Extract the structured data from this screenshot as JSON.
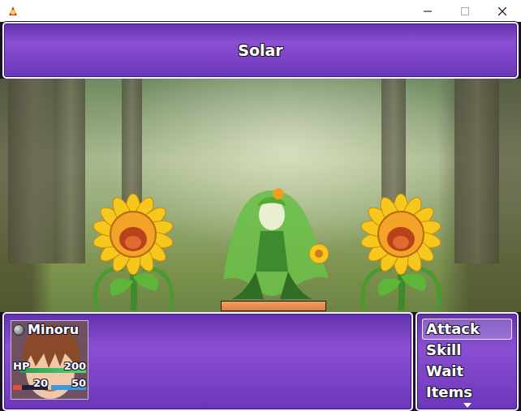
{
  "help_window": {
    "text": "Solar"
  },
  "enemies": [
    {
      "kind": "sunflower",
      "selected": false
    },
    {
      "kind": "dryad",
      "selected": true,
      "level": 1.0
    },
    {
      "kind": "sunflower",
      "selected": false
    }
  ],
  "actor": {
    "name": "Minoru",
    "hp_label": "HP",
    "hp": "200",
    "hp_level": 1.0,
    "gauges": [
      {
        "value": "20",
        "level": 0.25,
        "color": "#e0503a"
      },
      {
        "value": "50",
        "level": 1.0,
        "color": "#3a9ae0"
      }
    ]
  },
  "commands": [
    {
      "label": "Attack",
      "selected": true
    },
    {
      "label": "Skill",
      "selected": false
    },
    {
      "label": "Wait",
      "selected": false
    },
    {
      "label": "Items",
      "selected": false
    }
  ]
}
